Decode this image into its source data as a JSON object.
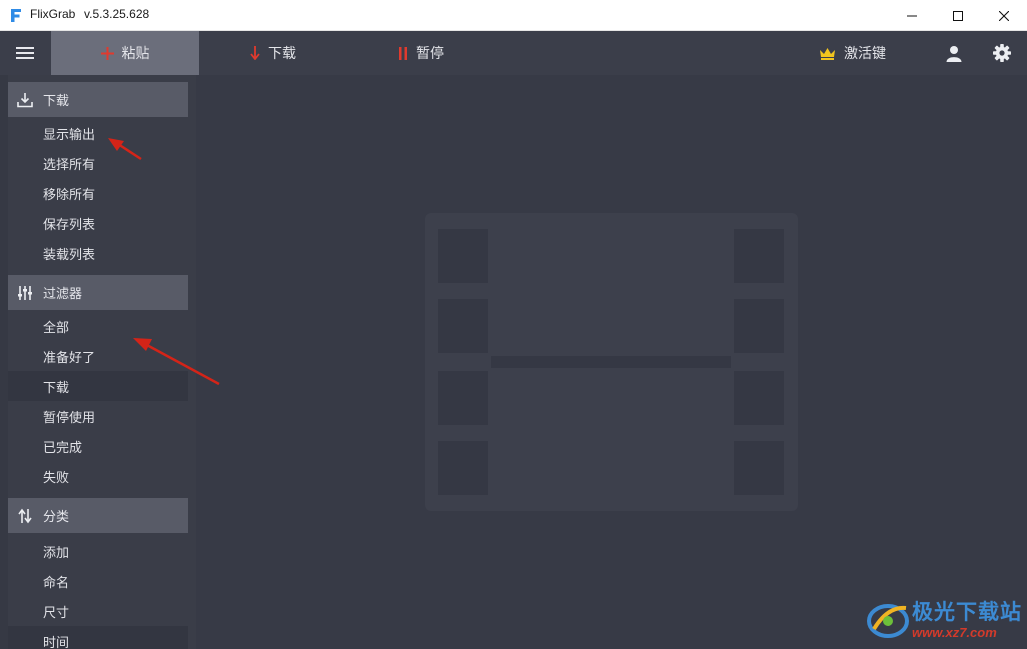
{
  "window": {
    "app_name": "FlixGrab",
    "version": "v.5.3.25.628"
  },
  "toolbar": {
    "paste_label": "粘贴",
    "download_label": "下载",
    "pause_label": "暂停",
    "activate_label": "激活键"
  },
  "sidebar": {
    "download_section": {
      "label": "下载",
      "items": [
        "显示输出",
        "选择所有",
        "移除所有",
        "保存列表",
        "装载列表"
      ]
    },
    "filter_section": {
      "label": "过滤器",
      "items": [
        "全部",
        "准备好了",
        "下载",
        "暂停使用",
        "已完成",
        "失败"
      ],
      "selected_index": 2
    },
    "sort_section": {
      "label": "分类",
      "items": [
        "添加",
        "命名",
        "尺寸",
        "时间"
      ]
    }
  },
  "watermark": {
    "text": "极光下载站",
    "url": "www.xz7.com"
  },
  "colors": {
    "toolbar_bg": "#3b3e4a",
    "main_bg": "#373a46",
    "accent_red": "#e03a2e",
    "crown_yellow": "#f2c51e"
  }
}
